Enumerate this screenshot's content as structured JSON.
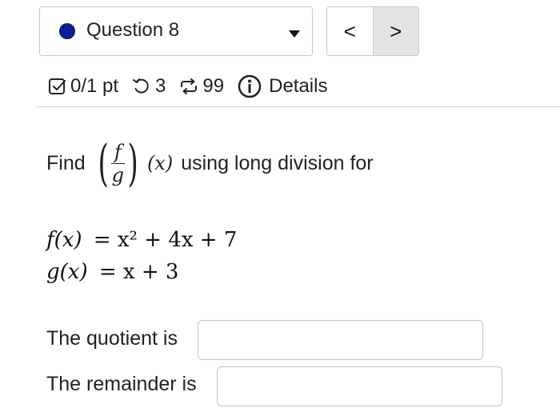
{
  "question_nav": {
    "current_label": "Question 8",
    "status_color": "#0a1f9c",
    "prev_label": "<",
    "next_label": ">"
  },
  "meta": {
    "score": "0/1 pt",
    "attempts": "3",
    "retries": "99",
    "details_label": "Details",
    "icons": [
      "checkbox-icon",
      "retry-icon",
      "refresh-icon",
      "info-icon"
    ]
  },
  "question": {
    "prompt_start": "Find",
    "fraction_num": "f",
    "fraction_den": "g",
    "fraction_arg": "(x)",
    "prompt_end": "using long division for",
    "f_lhs": "f(x)",
    "f_rhs": "= x² + 4x + 7",
    "g_lhs": "g(x)",
    "g_rhs": "= x + 3"
  },
  "answers": {
    "quotient_label": "The quotient is",
    "quotient_value": "",
    "remainder_label": "The remainder is",
    "remainder_value": ""
  }
}
